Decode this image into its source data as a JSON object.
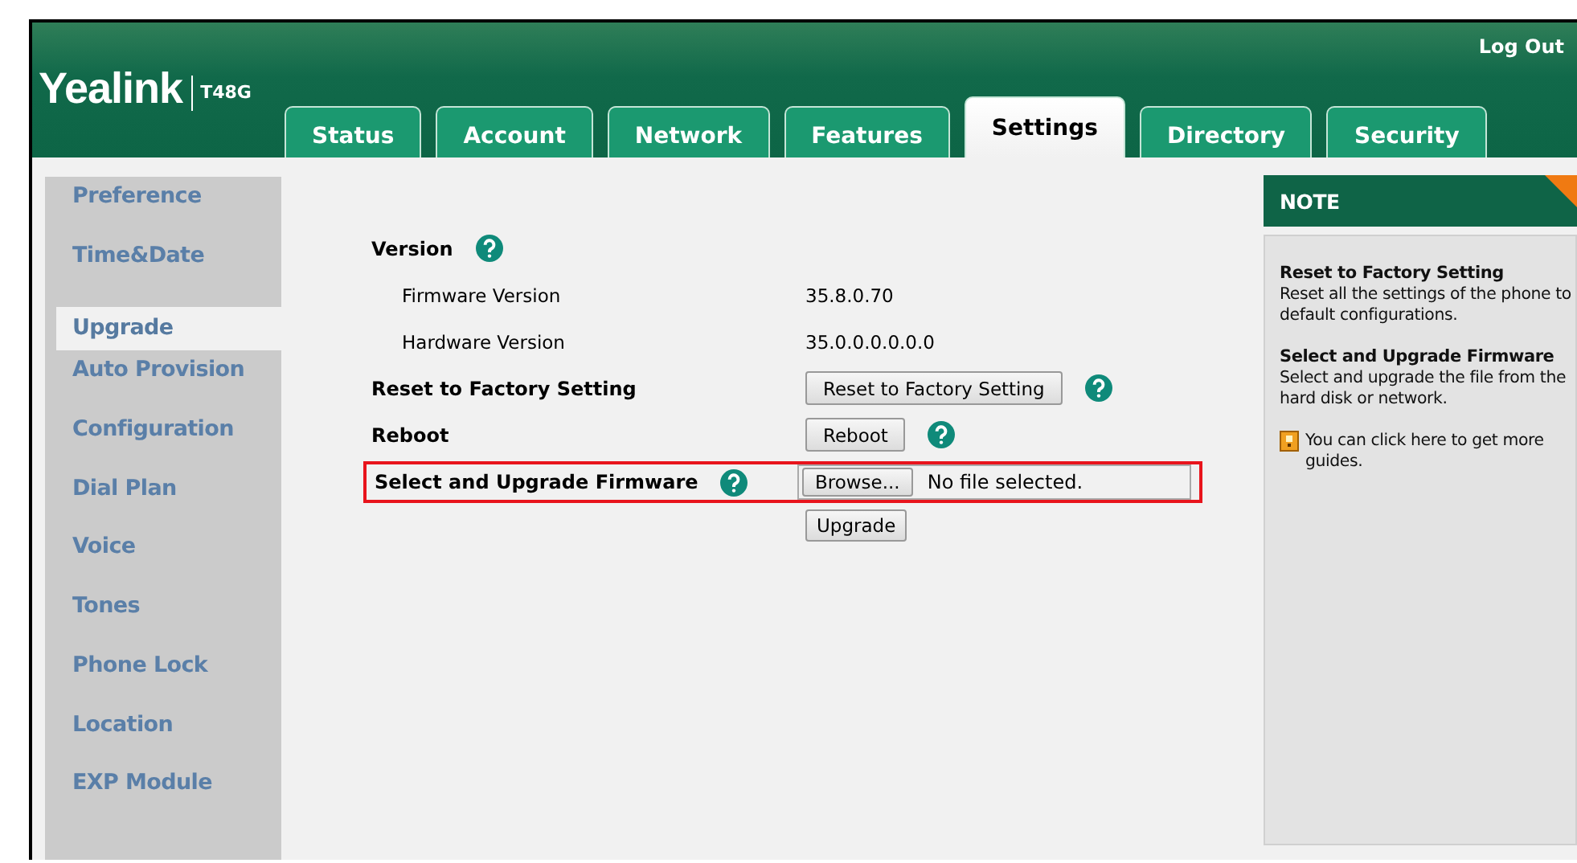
{
  "header": {
    "logo": "Yealink",
    "model": "T48G",
    "logout": "Log Out"
  },
  "tabs": [
    {
      "label": "Status",
      "selected": false
    },
    {
      "label": "Account",
      "selected": false
    },
    {
      "label": "Network",
      "selected": false
    },
    {
      "label": "Features",
      "selected": false
    },
    {
      "label": "Settings",
      "selected": true
    },
    {
      "label": "Directory",
      "selected": false
    },
    {
      "label": "Security",
      "selected": false
    }
  ],
  "sidebar": {
    "items": [
      {
        "label": "Preference",
        "selected": false
      },
      {
        "label": "Time&Date",
        "selected": false
      },
      {
        "label": "Upgrade",
        "selected": true
      },
      {
        "label": "Auto Provision",
        "selected": false
      },
      {
        "label": "Configuration",
        "selected": false
      },
      {
        "label": "Dial Plan",
        "selected": false
      },
      {
        "label": "Voice",
        "selected": false
      },
      {
        "label": "Tones",
        "selected": false
      },
      {
        "label": "Phone Lock",
        "selected": false
      },
      {
        "label": "Location",
        "selected": false
      },
      {
        "label": "EXP Module",
        "selected": false
      }
    ]
  },
  "settings": [
    {
      "kind": "heading",
      "label": "Version",
      "help": true
    },
    {
      "kind": "info",
      "label": "Firmware Version",
      "value": "35.8.0.70"
    },
    {
      "kind": "info",
      "label": "Hardware Version",
      "value": "35.0.0.0.0.0.0"
    },
    {
      "kind": "action",
      "label": "Reset to Factory Setting",
      "button": "Reset to Factory Setting",
      "help": true
    },
    {
      "kind": "action",
      "label": "Reboot",
      "button": "Reboot",
      "help": true
    },
    {
      "kind": "file",
      "label": "Select and Upgrade Firmware",
      "help": true,
      "highlighted": true,
      "browse": "Browse...",
      "file_status": "No file selected.",
      "button": "Upgrade"
    }
  ],
  "note": {
    "title": "NOTE",
    "sections": [
      {
        "heading": "Reset to Factory Setting",
        "text": "Reset all the settings of the phone to default configurations."
      },
      {
        "heading": "Select and Upgrade Firmware",
        "text": "Select and upgrade the file from the hard disk or network."
      }
    ],
    "guide": "You can click here to get more guides."
  }
}
